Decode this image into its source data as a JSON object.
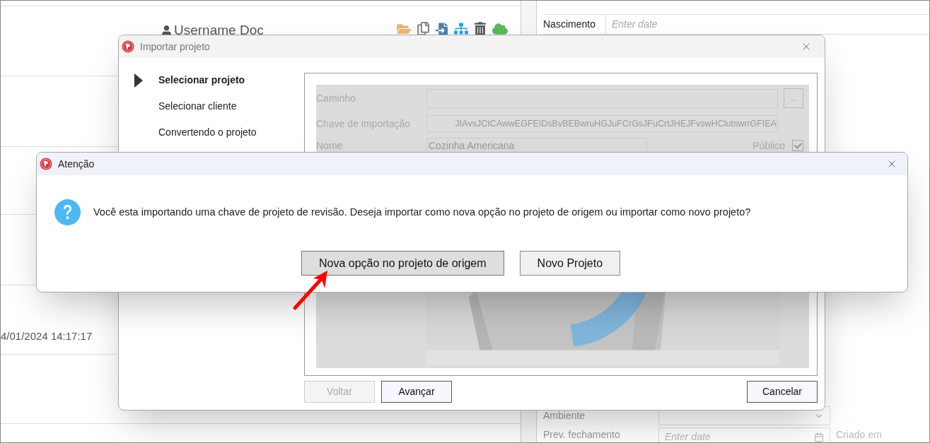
{
  "background": {
    "user_name": "Username Doc",
    "timestamp": "4/01/2024 14:17:17",
    "top_fields": [
      {
        "label": "Nascimento",
        "placeholder": "Enter date"
      }
    ],
    "bottom_fields": [
      {
        "kind": "select",
        "label": "Ambiente"
      },
      {
        "kind": "date",
        "label": "Prev. fechamento",
        "placeholder": "Enter date"
      }
    ],
    "created_label": "Criado em"
  },
  "import_dialog": {
    "title": "Importar projeto",
    "loading": true,
    "steps": [
      {
        "label": "Selecionar projeto",
        "selected": true
      },
      {
        "label": "Selecionar cliente",
        "selected": false
      },
      {
        "label": "Convertendo o projeto",
        "selected": false
      }
    ],
    "path": {
      "label": "Caminho",
      "button": "..."
    },
    "key": {
      "label": "Chave de importação",
      "value": "JIAvsJCtCAwwEGFEIDsBvBEBwruHGJuFCrGsJFuCrtJHEJFvswHClutswrrGFIEA"
    },
    "name": {
      "label": "Nome",
      "value": "Cozinha Americana"
    },
    "public": {
      "label": "Público",
      "checked": true
    },
    "buttons": [
      {
        "label": "Voltar",
        "disabled": true
      },
      {
        "label": "Avançar",
        "disabled": false
      },
      {
        "label": "Cancelar",
        "disabled": false
      }
    ]
  },
  "alert": {
    "title": "Atenção",
    "message": "Você esta importando uma chave de projeto de revisão. Deseja importar como nova opção no projeto de origem ou importar como novo projeto?",
    "buttons": [
      {
        "label": "Nova opção no projeto de origem",
        "highlighted": true
      },
      {
        "label": "Novo Projeto",
        "highlighted": false
      }
    ]
  }
}
